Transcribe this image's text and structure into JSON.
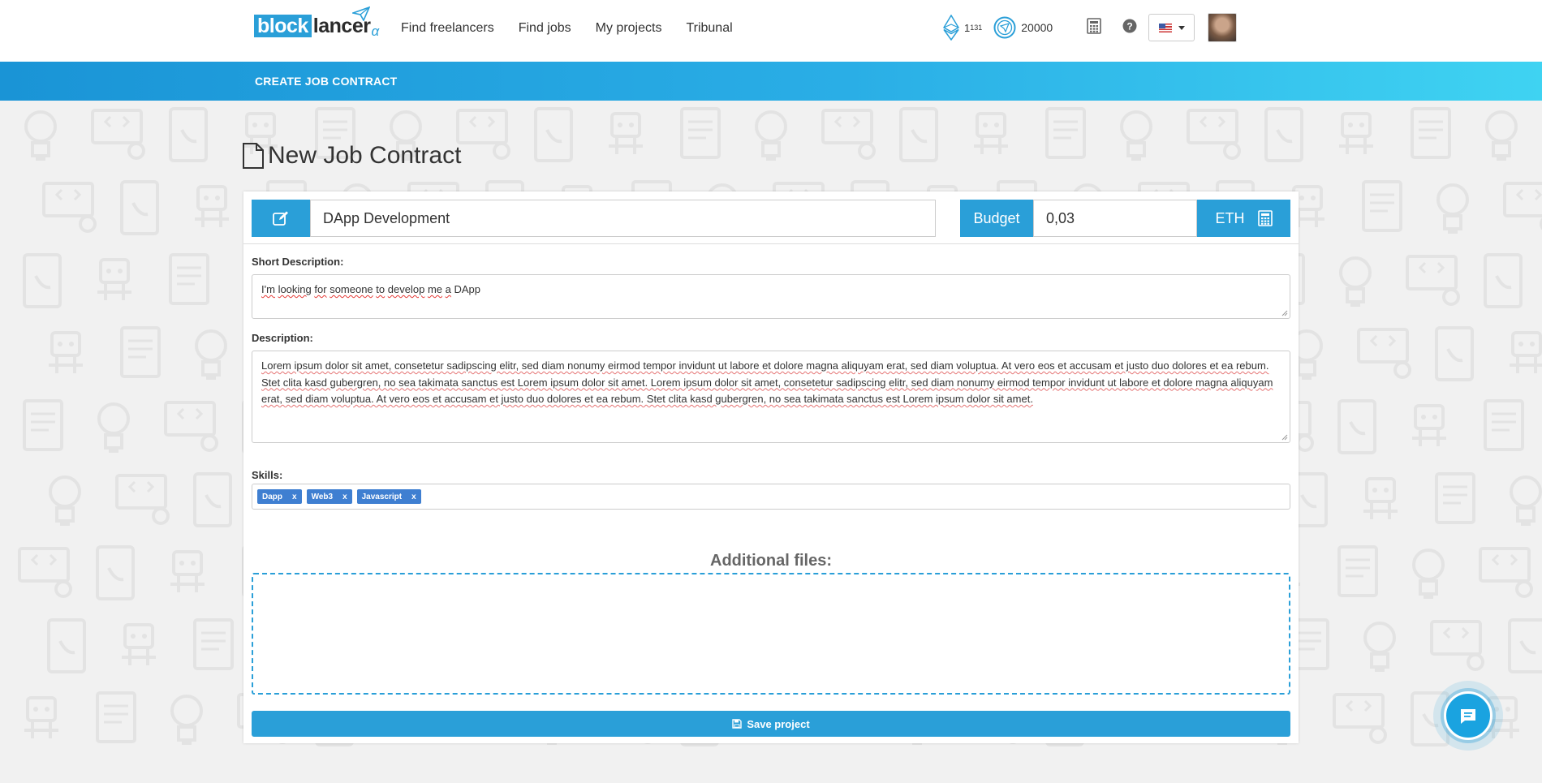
{
  "brand": {
    "logo_main": "block",
    "logo_rest": "lancer",
    "logo_suffix": "α"
  },
  "nav": {
    "links": [
      "Find freelancers",
      "Find jobs",
      "My projects",
      "Tribunal"
    ]
  },
  "account": {
    "eth_balance": "1",
    "eth_superscript": "131",
    "token_balance": "20000",
    "language": "en-US"
  },
  "subbar": {
    "title": "CREATE JOB CONTRACT"
  },
  "page": {
    "title": "New Job Contract"
  },
  "form": {
    "title_value": "DApp Development",
    "budget_label": "Budget",
    "budget_value": "0,03",
    "currency_label": "ETH",
    "short_description_label": "Short Description:",
    "short_description_words": [
      "I'm",
      "looking",
      "for",
      "someone",
      "to",
      "develop",
      "me",
      "a",
      "DApp"
    ],
    "description_label": "Description:",
    "description_value": "Lorem ipsum dolor sit amet, consetetur sadipscing elitr, sed diam nonumy eirmod tempor invidunt ut labore et dolore magna aliquyam erat, sed diam voluptua. At vero eos et accusam et justo duo dolores et ea rebum. Stet clita kasd gubergren, no sea takimata sanctus est Lorem ipsum dolor sit amet. Lorem ipsum dolor sit amet, consetetur sadipscing elitr, sed diam nonumy eirmod tempor invidunt ut labore et dolore magna aliquyam erat, sed diam voluptua. At vero eos et accusam et justo duo dolores et ea rebum. Stet clita kasd gubergren, no sea takimata sanctus est Lorem ipsum dolor sit amet.",
    "skills_label": "Skills:",
    "skills": [
      {
        "label": "Dapp",
        "remove": "x"
      },
      {
        "label": "Web3",
        "remove": "x"
      },
      {
        "label": "Javascript",
        "remove": "x"
      }
    ],
    "files_label": "Additional files:",
    "save_label": "Save project"
  },
  "colors": {
    "accent": "#2a9fd8",
    "tag": "#3f7fd1",
    "bar_start": "#1a94d6",
    "bar_end": "#3fd3f2"
  }
}
